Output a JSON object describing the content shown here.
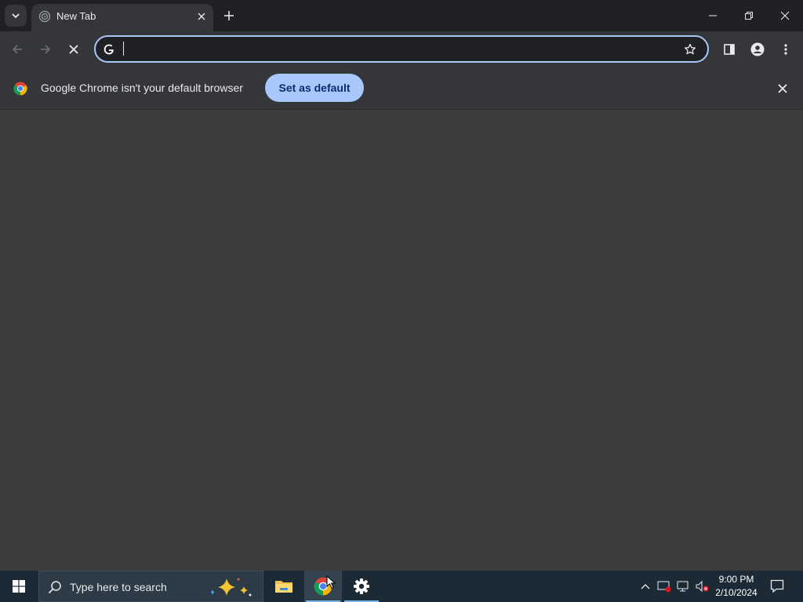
{
  "browser": {
    "tab": {
      "title": "New Tab"
    },
    "omnibox": {
      "value": "",
      "placeholder": ""
    },
    "infobar": {
      "message": "Google Chrome isn't your default browser",
      "button_label": "Set as default"
    }
  },
  "icons": {
    "tab_search": "chevron-down-icon",
    "tab_favicon": "new-tab-icon",
    "tab_close": "close-icon",
    "new_tab": "plus-icon",
    "minimize": "minimize-icon",
    "restore": "restore-icon",
    "close_window": "close-icon",
    "back": "arrow-left-icon",
    "forward": "arrow-right-icon",
    "stop": "stop-icon",
    "google": "google-g-icon",
    "bookmark": "star-icon",
    "side_panel": "side-panel-icon",
    "profile": "profile-icon",
    "menu": "more-vert-icon"
  },
  "taskbar": {
    "search_placeholder": "Type here to search",
    "apps": [
      "File Explorer",
      "Google Chrome",
      "Settings"
    ],
    "clock": {
      "time": "9:00 PM",
      "date": "2/10/2024"
    }
  },
  "colors": {
    "accent": "#a8c7fa",
    "titlebar": "#202124",
    "toolbar": "#35363a",
    "page": "#3c3c3c",
    "taskbar": "#1c2a35"
  }
}
